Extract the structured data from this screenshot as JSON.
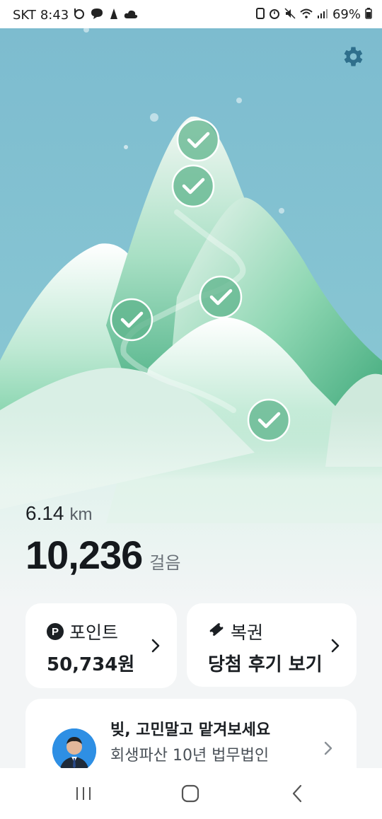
{
  "status_bar": {
    "carrier": "SKT",
    "time": "8:43",
    "battery": "69%",
    "left_icons": [
      "b-app-icon",
      "chat-bubble-icon",
      "mascot-icon",
      "cloud-icon"
    ],
    "right_icons": [
      "sim-icon",
      "alarm-icon",
      "mute-icon",
      "wifi-icon",
      "signal-icon",
      "battery-icon"
    ]
  },
  "scene": {
    "sky_color": "#7fbdd0",
    "mountain_colors": [
      "#e8f3ee",
      "#7fd0a8",
      "#3fae7e"
    ],
    "checkpoints_completed": 5
  },
  "stats": {
    "distance_value": "6.14",
    "distance_unit": "km",
    "steps_value": "10,236",
    "steps_unit": "걸음"
  },
  "cards": {
    "points": {
      "title": "포인트",
      "value": "50,734원",
      "icon": "p-icon"
    },
    "lotto": {
      "title": "복권",
      "value": "당첨 후기 보기",
      "icon": "ticket-icon"
    }
  },
  "ad": {
    "title": "빚, 고민말고 맡겨보세요",
    "subtitle": "회생파산 10년 법무법인"
  },
  "nav": {
    "buttons": [
      "recent-apps",
      "home",
      "back"
    ]
  }
}
